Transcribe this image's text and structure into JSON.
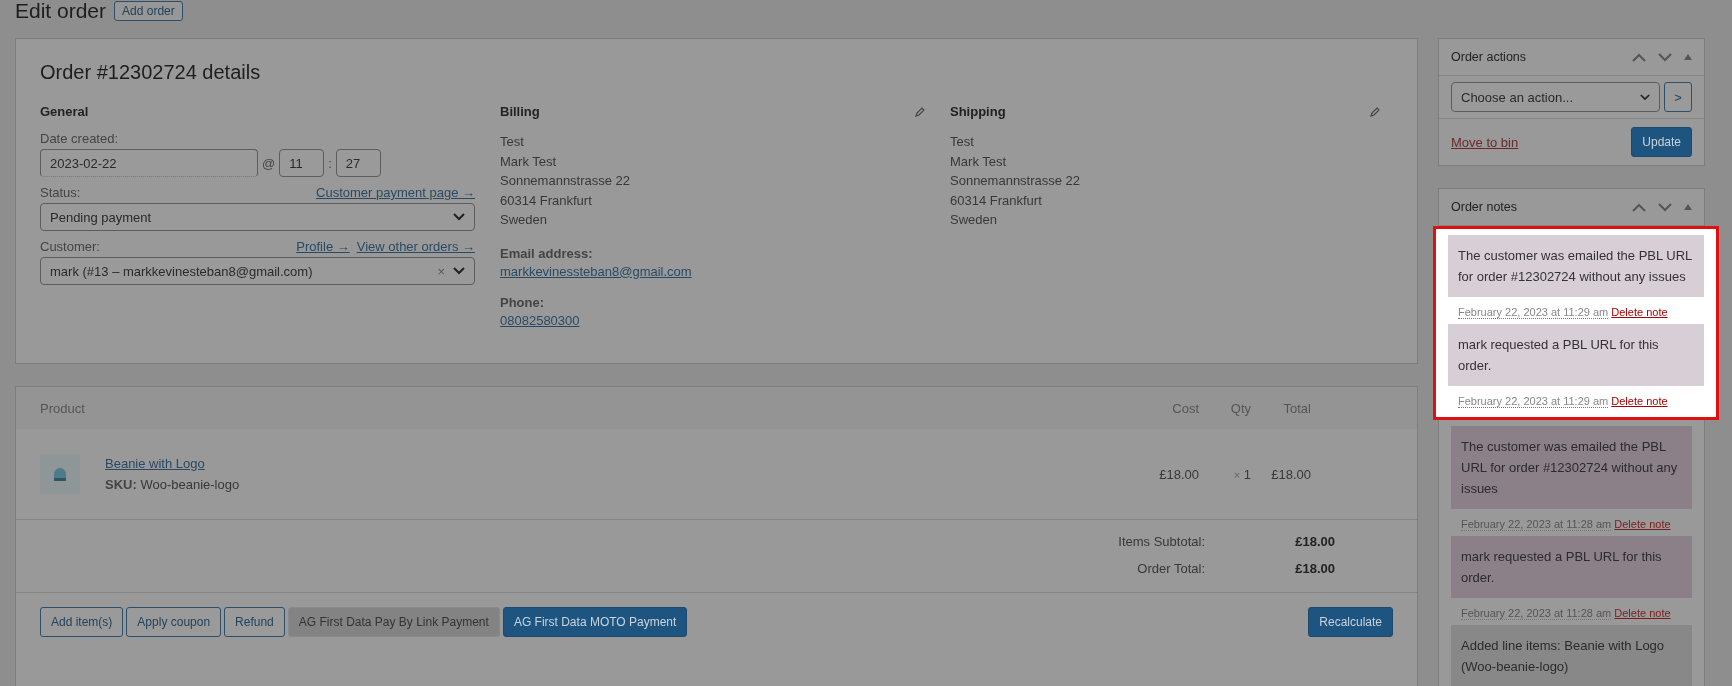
{
  "page": {
    "title": "Edit order",
    "add_button": "Add order"
  },
  "order": {
    "heading": "Order #12302724 details",
    "general": {
      "heading": "General",
      "date_label": "Date created:",
      "date": "2023-02-22",
      "at": "@",
      "hour": "11",
      "colon": ":",
      "minute": "27",
      "status_label": "Status:",
      "payment_link": "Customer payment page →",
      "status": "Pending payment",
      "customer_label": "Customer:",
      "profile_link": "Profile →",
      "orders_link": "View other orders →",
      "customer": "mark (#13 – markkevinesteban8@gmail.com)",
      "clear": "×"
    },
    "billing": {
      "heading": "Billing",
      "lines": [
        "Test",
        "Mark Test",
        "Sonnemannstrasse 22",
        "60314 Frankfurt",
        "Sweden"
      ],
      "email_label": "Email address:",
      "email": "markkevinessteban8@gmail.com",
      "phone_label": "Phone:",
      "phone": "08082580300"
    },
    "shipping": {
      "heading": "Shipping",
      "lines": [
        "Test",
        "Mark Test",
        "Sonnemannstrasse 22",
        "60314 Frankfurt",
        "Sweden"
      ]
    }
  },
  "items": {
    "columns": [
      "Product",
      "Cost",
      "Qty",
      "Total"
    ],
    "rows": [
      {
        "name": "Beanie with Logo",
        "sku_label": "SKU:",
        "sku": "Woo-beanie-logo",
        "cost": "£18.00",
        "qty_x": "×",
        "qty": "1",
        "total": "£18.00"
      }
    ],
    "totals": [
      {
        "label": "Items Subtotal:",
        "value": "£18.00"
      },
      {
        "label": "Order Total:",
        "value": "£18.00"
      }
    ],
    "buttons": [
      {
        "label": "Add item(s)",
        "kind": "outline"
      },
      {
        "label": "Apply coupon",
        "kind": "outline"
      },
      {
        "label": "Refund",
        "kind": "outline"
      },
      {
        "label": "AG First Data Pay By Link Payment",
        "kind": "grey"
      },
      {
        "label": "AG First Data MOTO Payment",
        "kind": "primary"
      }
    ],
    "recalculate": "Recalculate"
  },
  "order_actions": {
    "title": "Order actions",
    "select": "Choose an action...",
    "go": ">",
    "bin": "Move to bin",
    "update": "Update"
  },
  "order_notes": {
    "title": "Order notes",
    "highlighted": [
      {
        "text": "The customer was emailed the PBL URL for order #12302724 without any issues",
        "date": "February 22, 2023 at 11:29 am",
        "delete": "Delete note",
        "kind": "customer"
      },
      {
        "text": "mark requested a PBL URL for this order.",
        "date": "February 22, 2023 at 11:29 am",
        "delete": "Delete note",
        "kind": "customer"
      }
    ],
    "others": [
      {
        "text": "The customer was emailed the PBL URL for order #12302724 without any issues",
        "date": "February 22, 2023 at 11:28 am",
        "delete": "Delete note",
        "kind": "customer"
      },
      {
        "text": "mark requested a PBL URL for this order.",
        "date": "February 22, 2023 at 11:28 am",
        "delete": "Delete note",
        "kind": "customer"
      },
      {
        "text": "Added line items: Beanie with Logo (Woo-beanie-logo)",
        "kind": "system"
      }
    ]
  }
}
